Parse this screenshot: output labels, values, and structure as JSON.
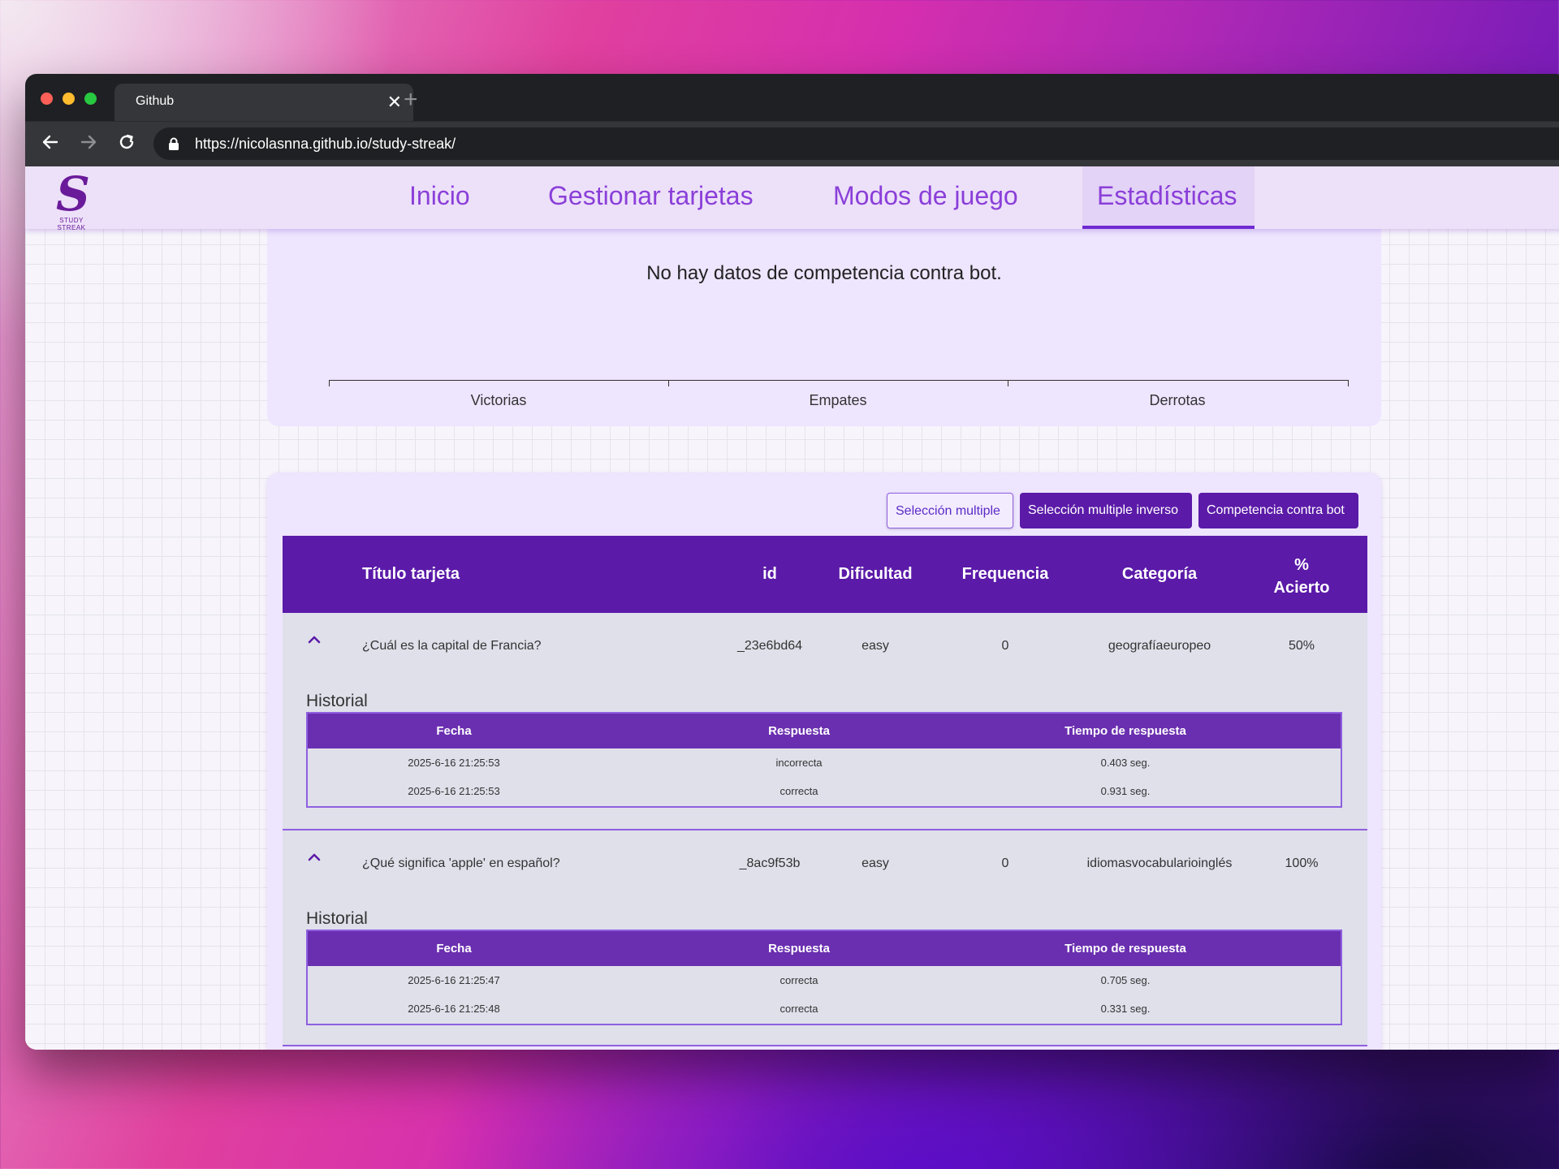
{
  "browser": {
    "tab_title": "Github",
    "close_glyph": "✕",
    "new_tab_glyph": "+",
    "url": "https://nicolasnna.github.io/study-streak/"
  },
  "navbar": {
    "logo_glyph": "S",
    "logo_text": "STUDY STREAK",
    "items": [
      "Inicio",
      "Gestionar tarjetas",
      "Modos de juego",
      "Estadísticas"
    ],
    "active": "Estadísticas"
  },
  "bot_stats": {
    "message": "No hay datos de competencia contra bot.",
    "categories": [
      "Victorias",
      "Empates",
      "Derrotas"
    ]
  },
  "filters": [
    "Selección multiple",
    "Selección multiple inverso",
    "Competencia contra bot"
  ],
  "table": {
    "headers": [
      "Título tarjeta",
      "id",
      "Dificultad",
      "Frequencia",
      "Categoría",
      "%\nAcierto"
    ],
    "rows": [
      {
        "title": "¿Cuál es la capital de Francia?",
        "id": "_23e6bd64",
        "difficulty": "easy",
        "frequency": "0",
        "category": "geografíaeuropeo",
        "accuracy": "50%",
        "history_title": "Historial",
        "history_headers": [
          "Fecha",
          "Respuesta",
          "Tiempo de respuesta"
        ],
        "history": [
          [
            "2025-6-16 21:25:53",
            "incorrecta",
            "0.403 seg."
          ],
          [
            "2025-6-16 21:25:53",
            "correcta",
            "0.931 seg."
          ]
        ]
      },
      {
        "title": "¿Qué significa 'apple' en español?",
        "id": "_8ac9f53b",
        "difficulty": "easy",
        "frequency": "0",
        "category": "idiomasvocabularioinglés",
        "accuracy": "100%",
        "history_title": "Historial",
        "history_headers": [
          "Fecha",
          "Respuesta",
          "Tiempo de respuesta"
        ],
        "history": [
          [
            "2025-6-16 21:25:47",
            "correcta",
            "0.705 seg."
          ],
          [
            "2025-6-16 21:25:48",
            "correcta",
            "0.331 seg."
          ]
        ]
      }
    ]
  },
  "colors": {
    "primary": "#5b1aa8",
    "accent": "#8b3fd9",
    "card": "#eee5ff"
  }
}
